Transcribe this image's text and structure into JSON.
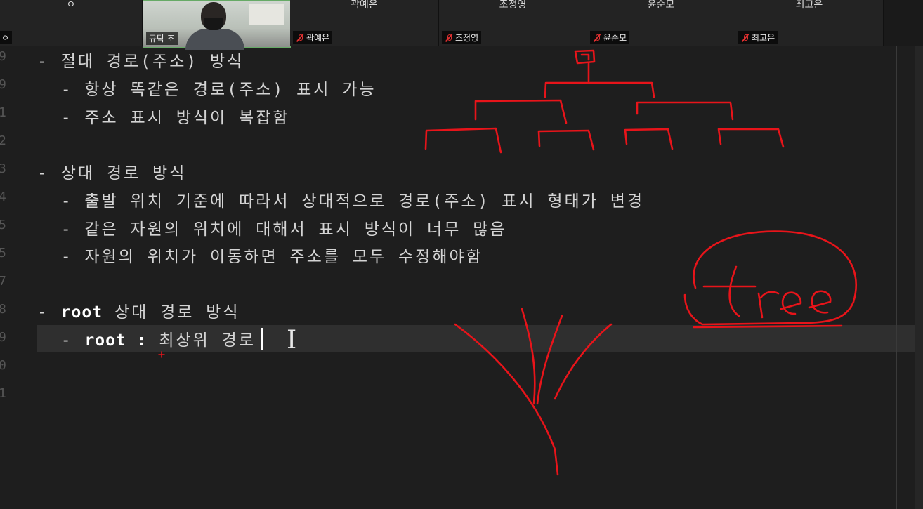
{
  "participants": {
    "tile0": {
      "top": "ㅇ",
      "label": "ㅇ"
    },
    "tile1": {
      "label": "규탁 조"
    },
    "tile2": {
      "top": "곽예은",
      "label": "곽예은"
    },
    "tile3": {
      "top": "조정영",
      "label": "조정영"
    },
    "tile4": {
      "top": "윤순모",
      "label": "윤순모"
    },
    "tile5": {
      "top": "최고은",
      "label": "최고은"
    }
  },
  "editor": {
    "line_numbers": [
      "9",
      "9",
      "1",
      "2",
      "3",
      "4",
      "5",
      "5",
      "7",
      "8",
      "9",
      "0",
      "1"
    ],
    "lines": {
      "l1": "- 절대 경로(주소) 방식",
      "l2": "  - 항상 똑같은 경로(주소) 표시 가능",
      "l3": "  - 주소 표시 방식이 복잡함",
      "l5": "- 상대 경로 방식",
      "l6": "  - 출발 위치 기준에 따라서 상대적으로 경로(주소) 표시 형태가 변경",
      "l7": "  - 같은 자원의 위치에 대해서 표시 방식이 너무 많음",
      "l8": "  - 자원의 위치가 이동하면 주소를 모두 수정해야함",
      "l10_dash": "- ",
      "l10_bold": "root",
      "l10_rest": " 상대 경로 방식",
      "l11_dash": "  - ",
      "l11_bold": "root :",
      "l11_rest": " 최상위 경로"
    }
  },
  "annotation": {
    "word": "tree",
    "color": "#e8141a"
  }
}
